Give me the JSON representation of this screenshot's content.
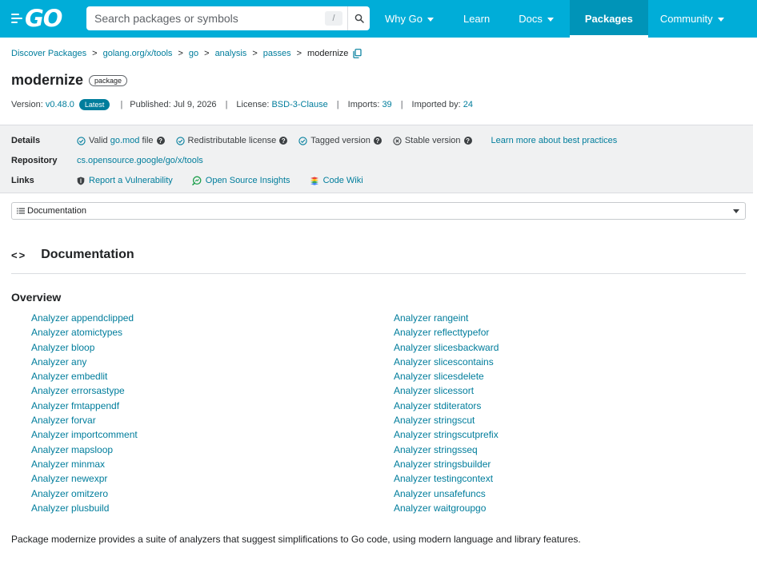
{
  "header": {
    "logo_text": "GO",
    "search_placeholder": "Search packages or symbols",
    "search_shortcut": "/",
    "nav": [
      {
        "label": "Why Go",
        "dropdown": true
      },
      {
        "label": "Learn",
        "dropdown": false
      },
      {
        "label": "Docs",
        "dropdown": true
      },
      {
        "label": "Packages",
        "dropdown": false,
        "active": true
      },
      {
        "label": "Community",
        "dropdown": true
      }
    ]
  },
  "breadcrumb": [
    "Discover Packages",
    "golang.org/x/tools",
    "go",
    "analysis",
    "passes",
    "modernize"
  ],
  "package": {
    "name": "modernize",
    "badge": "package",
    "version_label": "Version:",
    "version": "v0.48.0",
    "latest_badge": "Latest",
    "published_label": "Published:",
    "published": "Jul 9, 2026",
    "license_label": "License:",
    "license": "BSD-3-Clause",
    "imports_label": "Imports:",
    "imports": "39",
    "imported_by_label": "Imported by:",
    "imported_by": "24"
  },
  "details": {
    "details_label": "Details",
    "valid_prefix": "Valid",
    "valid_link": "go.mod",
    "valid_suffix": "file",
    "redistributable": "Redistributable license",
    "tagged": "Tagged version",
    "stable": "Stable version",
    "learn_more": "Learn more about best practices",
    "repository_label": "Repository",
    "repository": "cs.opensource.google/go/x/tools",
    "links_label": "Links",
    "links": [
      "Report a Vulnerability",
      "Open Source Insights",
      "Code Wiki"
    ]
  },
  "doc_selector": "Documentation",
  "documentation": {
    "heading": "Documentation",
    "overview": "Overview",
    "analyzers_left": [
      "Analyzer appendclipped",
      "Analyzer atomictypes",
      "Analyzer bloop",
      "Analyzer any",
      "Analyzer embedlit",
      "Analyzer errorsastype",
      "Analyzer fmtappendf",
      "Analyzer forvar",
      "Analyzer importcomment",
      "Analyzer mapsloop",
      "Analyzer minmax",
      "Analyzer newexpr",
      "Analyzer omitzero",
      "Analyzer plusbuild"
    ],
    "analyzers_right": [
      "Analyzer rangeint",
      "Analyzer reflecttypefor",
      "Analyzer slicesbackward",
      "Analyzer slicescontains",
      "Analyzer slicesdelete",
      "Analyzer slicessort",
      "Analyzer stditerators",
      "Analyzer stringscut",
      "Analyzer stringscutprefix",
      "Analyzer stringsseq",
      "Analyzer stringsbuilder",
      "Analyzer testingcontext",
      "Analyzer unsafefuncs",
      "Analyzer waitgroupgo"
    ],
    "description": "Package modernize provides a suite of analyzers that suggest simplifications to Go code, using modern language and library features."
  },
  "colors": {
    "brand": "#00add8",
    "brand_active": "#0094b8",
    "link": "#007d9c",
    "panel_bg": "#f0f1f2"
  }
}
